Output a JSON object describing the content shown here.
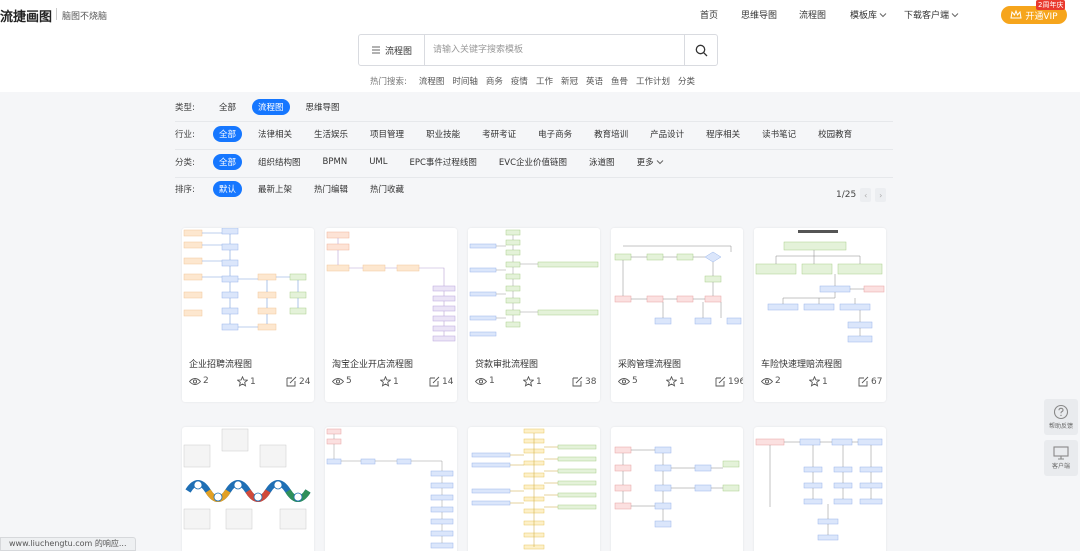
{
  "header": {
    "logo_text": "流捷画图",
    "slogan": "脑图不烧脑",
    "nav": [
      "首页",
      "思维导图",
      "流程图",
      "模板库",
      "下载客户端"
    ],
    "vip_label": "开通VIP",
    "vip_badge": "2周年庆"
  },
  "search": {
    "type_label": "流程图",
    "placeholder": "请输入关键字搜索模板",
    "hot_label": "热门搜索:",
    "hot_terms": [
      "流程图",
      "时间轴",
      "商务",
      "疫情",
      "工作",
      "新冠",
      "英语",
      "鱼骨",
      "工作计划",
      "分类"
    ]
  },
  "filters": {
    "type": {
      "label": "类型:",
      "options": [
        "全部",
        "流程图",
        "思维导图"
      ],
      "active": 1
    },
    "industry": {
      "label": "行业:",
      "options": [
        "全部",
        "法律相关",
        "生活娱乐",
        "项目管理",
        "职业技能",
        "考研考证",
        "电子商务",
        "教育培训",
        "产品设计",
        "程序相关",
        "读书笔记",
        "校园教育"
      ],
      "active": 0
    },
    "category": {
      "label": "分类:",
      "options": [
        "全部",
        "组织结构图",
        "BPMN",
        "UML",
        "EPC事件过程线图",
        "EVC企业价值链图",
        "泳道图",
        "更多"
      ],
      "active": 0
    },
    "sort": {
      "label": "排序:",
      "options": [
        "默认",
        "最新上架",
        "热门编辑",
        "热门收藏"
      ],
      "active": 0
    }
  },
  "pagination": {
    "text": "1/25",
    "prev": "‹",
    "next": "›"
  },
  "cards": [
    {
      "title": "企业招聘流程图",
      "views": "2",
      "stars": "1",
      "edits": "24"
    },
    {
      "title": "淘宝企业开店流程图",
      "views": "5",
      "stars": "1",
      "edits": "14"
    },
    {
      "title": "贷款审批流程图",
      "views": "1",
      "stars": "1",
      "edits": "38"
    },
    {
      "title": "采购管理流程图",
      "views": "5",
      "stars": "1",
      "edits": "196"
    },
    {
      "title": "车险快速理赔流程图",
      "views": "2",
      "stars": "1",
      "edits": "67"
    }
  ],
  "side": {
    "feedback_label": "帮助反馈",
    "client_label": "客户端"
  },
  "status_text": "www.liuchengtu.com 的响应...",
  "colors": {
    "accent": "#1677ff",
    "vip": "#f6a51c",
    "badge": "#e93a2e"
  }
}
